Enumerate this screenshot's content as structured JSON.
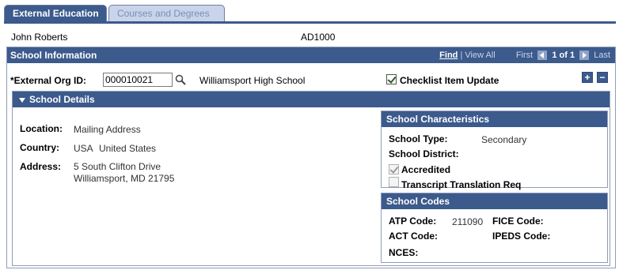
{
  "tabs": [
    {
      "label": "External Education",
      "active": true
    },
    {
      "label": "Courses and Degrees",
      "active": false
    }
  ],
  "person": {
    "name": "John Roberts",
    "id": "AD1000"
  },
  "school_information": {
    "title": "School Information",
    "nav": {
      "find": "Find",
      "view_all": "View All",
      "first": "First",
      "range": "1 of 1",
      "last": "Last"
    },
    "external_org_label": "*External Org ID:",
    "external_org_value": "000010021",
    "school_name": "Williamsport High School",
    "checklist_label": "Checklist Item Update",
    "checklist_checked": true,
    "add_button": "+",
    "remove_button": "−"
  },
  "school_details": {
    "title": "School Details",
    "location_label": "Location:",
    "location_value": "Mailing Address",
    "country_label": "Country:",
    "country_code": "USA",
    "country_name": "United States",
    "address_label": "Address:",
    "address_line1": "5 South Clifton Drive",
    "address_line2": "Williamsport, MD 21795"
  },
  "school_characteristics": {
    "title": "School Characteristics",
    "type_label": "School Type:",
    "type_value": "Secondary",
    "district_label": "School District:",
    "accredited_label": "Accredited",
    "accredited_checked": true,
    "transcript_label": "Transcript Translation Req",
    "transcript_checked": false
  },
  "school_codes": {
    "title": "School Codes",
    "atp_label": "ATP Code:",
    "atp_value": "211090",
    "fice_label": "FICE Code:",
    "act_label": "ACT Code:",
    "ipeds_label": "IPEDS Code:",
    "nces_label": "NCES:"
  },
  "colors": {
    "header": "#3c5a8c",
    "tab_inactive": "#c9d4ea",
    "border": "#8f9dba"
  },
  "icons": {
    "search": "magnifier-icon",
    "collapse": "triangle-down-icon",
    "prev": "arrow-left-icon",
    "next": "arrow-right-icon"
  }
}
